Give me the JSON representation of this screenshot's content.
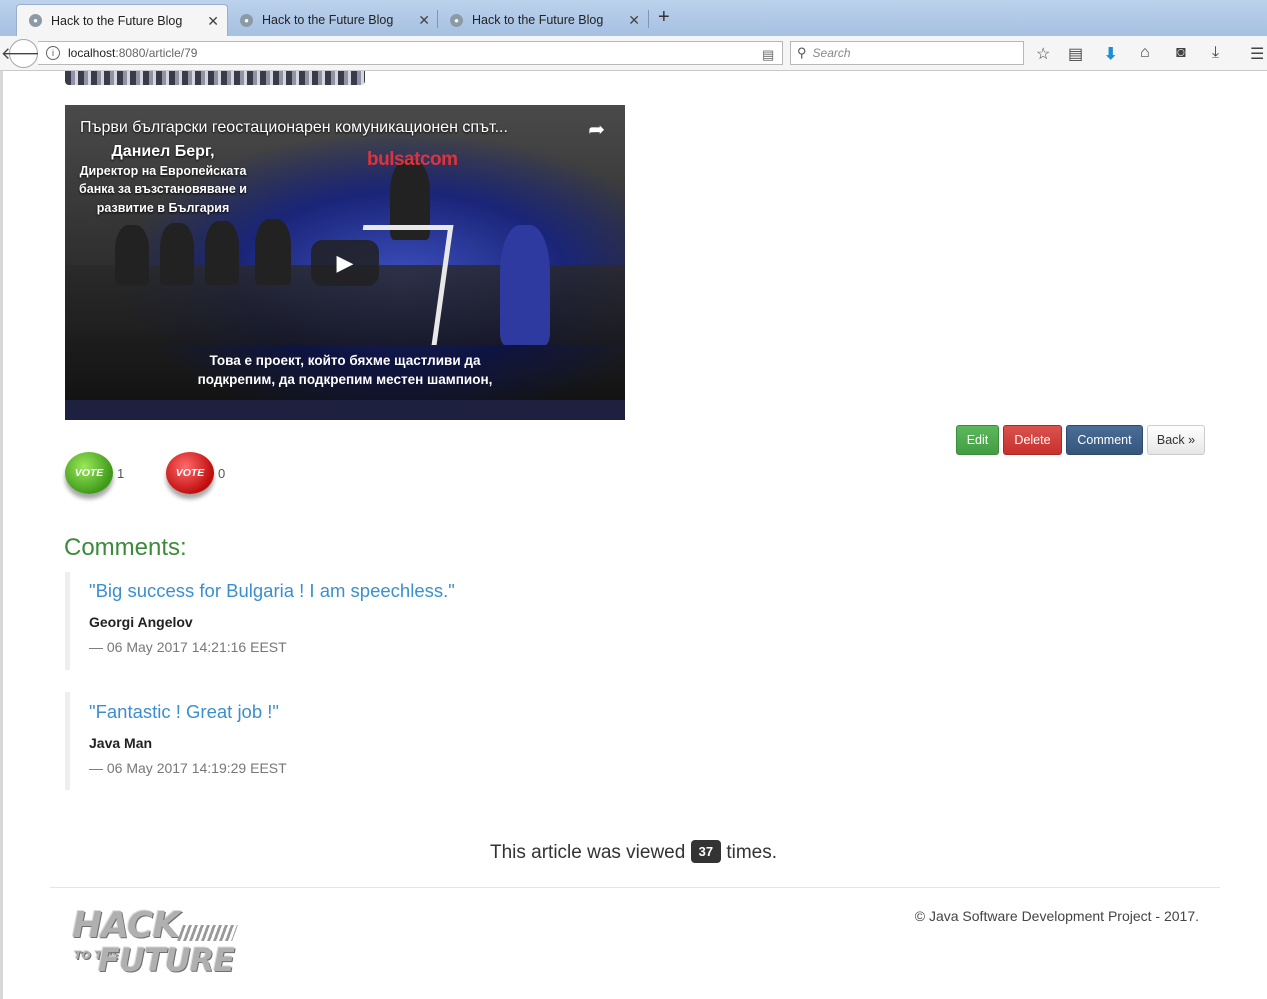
{
  "browser": {
    "tabs": [
      {
        "title": "Hack to the Future Blog",
        "active": true
      },
      {
        "title": "Hack to the Future Blog",
        "active": false
      },
      {
        "title": "Hack to the Future Blog",
        "active": false
      }
    ],
    "url_host": "localhost",
    "url_rest": ":8080/article/79",
    "search_placeholder": "Search"
  },
  "video": {
    "title": "Първи български геостационарен комуникационен спът...",
    "speaker_name": "Даниел Берг,",
    "speaker_role": "Директор на Европейската банка за възстановяване и развитие в България",
    "brand": "bulsatcom",
    "subtitle_line1": "Това е проект, който бяхме щастливи да",
    "subtitle_line2": "подкрепим, да подкрепим местен шампион,"
  },
  "actions": {
    "edit": "Edit",
    "delete": "Delete",
    "comment": "Comment",
    "back": "Back »"
  },
  "votes": {
    "up_label": "VOTE",
    "up_count": "1",
    "down_label": "VOTE",
    "down_count": "0"
  },
  "comments": {
    "heading": "Comments:",
    "items": [
      {
        "text": "\"Big success for Bulgaria ! I am speechless.\"",
        "author": "Georgi Angelov",
        "date": "— 06 May 2017 14:21:16 EEST"
      },
      {
        "text": "\"Fantastic ! Great job !\"",
        "author": "Java Man",
        "date": "— 06 May 2017 14:19:29 EEST"
      }
    ]
  },
  "views": {
    "prefix": "This article was viewed",
    "count": "37",
    "suffix": "times."
  },
  "footer": {
    "copyright": "© Java Software Development Project - 2017.",
    "logo_line1": "HACK",
    "logo_line2": "TO THE",
    "logo_line3": "FUTURE"
  },
  "colors": {
    "tabbar": "#aec7e6",
    "comments_heading": "#3c8b3c",
    "comment_text": "#3a8fd0",
    "edit": "#5cb85c",
    "delete": "#d9534f",
    "comment_btn": "#35557c"
  }
}
